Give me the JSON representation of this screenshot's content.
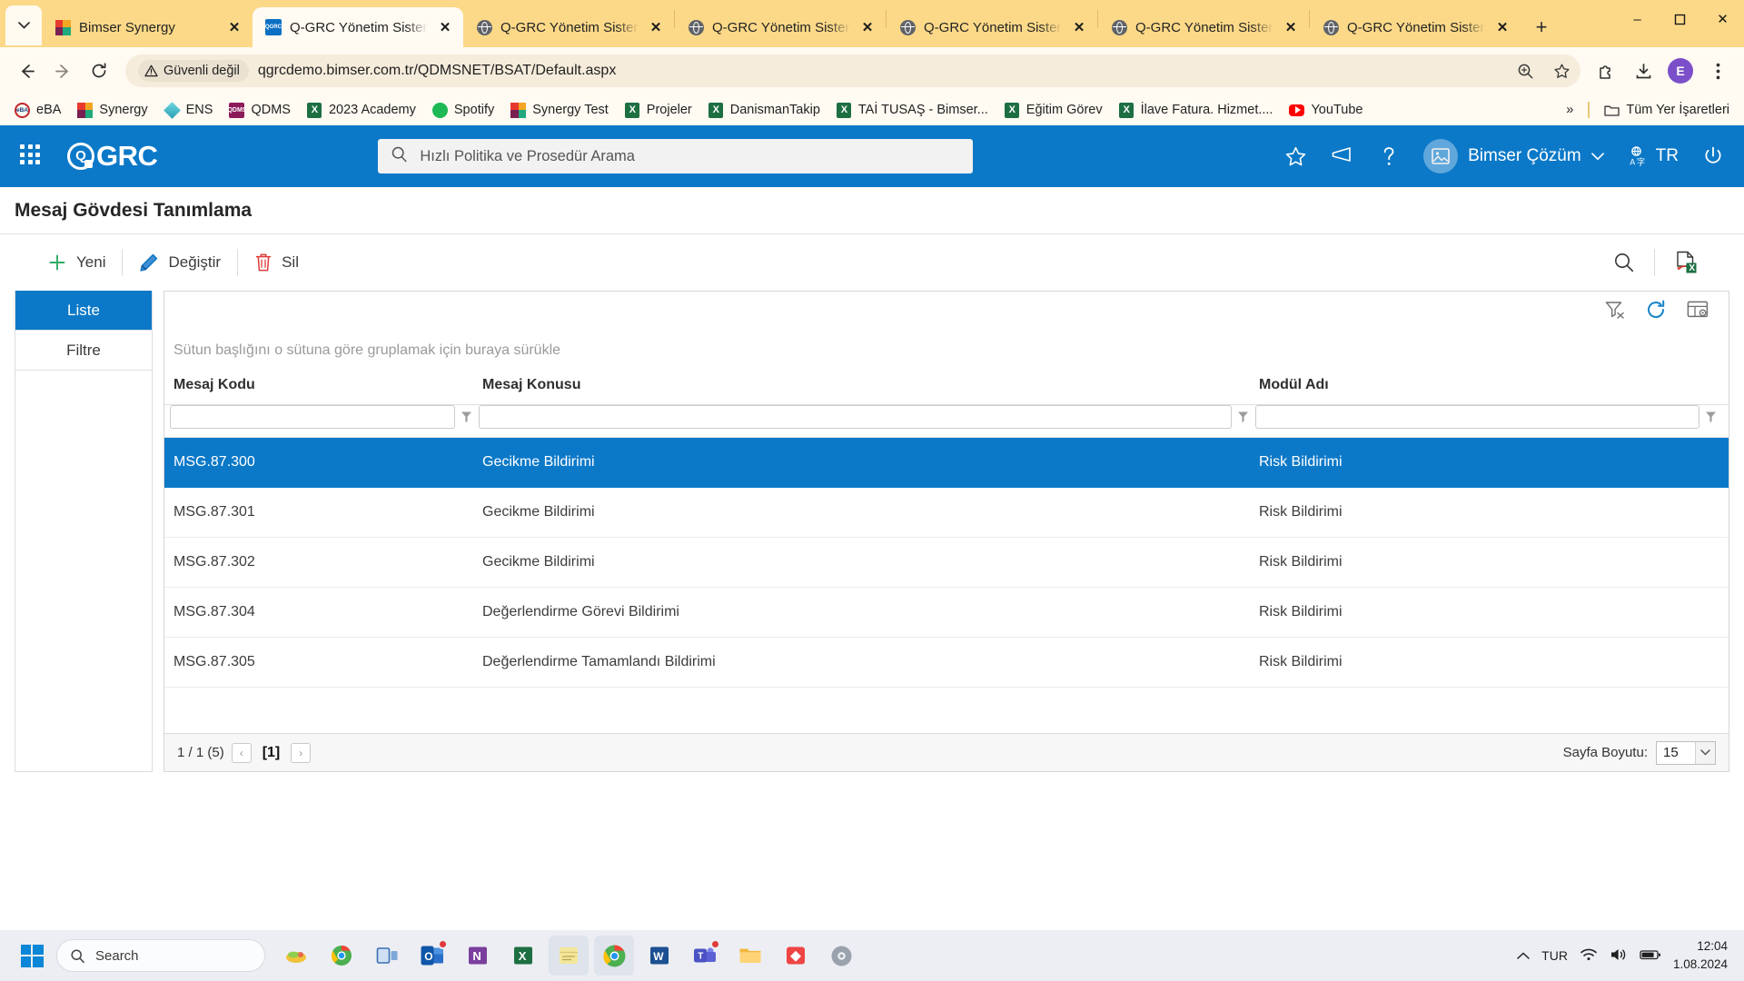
{
  "browser": {
    "tab_list_icon": "chevron-down-icon",
    "tabs": [
      {
        "title": "Bimser Synergy",
        "favicon": "synergy-icon",
        "active": false
      },
      {
        "title": "Q-GRC Yönetim Sistemi",
        "favicon": "qgrc-icon",
        "active": true
      },
      {
        "title": "Q-GRC Yönetim Sistemi",
        "favicon": "globe-icon",
        "active": false
      },
      {
        "title": "Q-GRC Yönetim Sistemi",
        "favicon": "globe-icon",
        "active": false
      },
      {
        "title": "Q-GRC Yönetim Sistemi",
        "favicon": "globe-icon",
        "active": false
      },
      {
        "title": "Q-GRC Yönetim Sistemi",
        "favicon": "globe-icon",
        "active": false
      },
      {
        "title": "Q-GRC Yönetim Sistemi",
        "favicon": "globe-icon",
        "active": false
      }
    ],
    "new_tab_label": "+",
    "window_controls": {
      "minimize": "–",
      "maximize": "☐",
      "close": "✕"
    },
    "nav": {
      "back": "back-icon",
      "forward": "forward-icon",
      "reload": "reload-icon"
    },
    "security_label": "Güvenli değil",
    "url": "qgrcdemo.bimser.com.tr/QDMSNET/BSAT/Default.aspx",
    "profile_initial": "E",
    "bookmarks": [
      {
        "label": "eBA",
        "icon": "eba-icon"
      },
      {
        "label": "Synergy",
        "icon": "synergy-icon"
      },
      {
        "label": "ENS",
        "icon": "ens-icon"
      },
      {
        "label": "QDMS",
        "icon": "qdms-icon"
      },
      {
        "label": "2023 Academy",
        "icon": "excel-icon"
      },
      {
        "label": "Spotify",
        "icon": "spotify-icon"
      },
      {
        "label": "Synergy Test",
        "icon": "synergy-icon"
      },
      {
        "label": "Projeler",
        "icon": "excel-icon"
      },
      {
        "label": "DanismanTakip",
        "icon": "excel-icon"
      },
      {
        "label": "TAİ TUSAŞ - Bimser...",
        "icon": "excel-icon"
      },
      {
        "label": "Eğitim Görev",
        "icon": "excel-icon"
      },
      {
        "label": "İlave Fatura. Hizmet....",
        "icon": "excel-icon"
      },
      {
        "label": "YouTube",
        "icon": "youtube-icon"
      }
    ],
    "bookmarks_overflow": "»",
    "all_bookmarks_label": "Tüm Yer İşaretleri"
  },
  "app_header": {
    "apps_grid_icon": "apps-grid-icon",
    "brand_mark": "Q",
    "brand_text": "GRC",
    "search_placeholder": "Hızlı Politika ve Prosedür Arama",
    "search_value": "",
    "icons": {
      "favorites": "star-icon",
      "announcements": "megaphone-icon",
      "help": "question-mark-icon",
      "avatar": "user-avatar-icon",
      "language": "translate-icon",
      "logout": "power-icon"
    },
    "user_name": "Bimser Çözüm",
    "user_caret": "chevron-down-icon",
    "language": "TR"
  },
  "page": {
    "title": "Mesaj Gövdesi Tanımlama"
  },
  "toolbar": {
    "new_label": "Yeni",
    "new_icon": "plus-icon",
    "edit_label": "Değiştir",
    "edit_icon": "pencil-icon",
    "delete_label": "Sil",
    "delete_icon": "trash-icon",
    "search_icon": "magnifier-icon",
    "export_excel_icon": "export-excel-icon"
  },
  "side_tabs": [
    {
      "label": "Liste",
      "active": true
    },
    {
      "label": "Filtre",
      "active": false
    }
  ],
  "grid": {
    "tool_icons": {
      "clear_filter": "clear-filter-icon",
      "refresh": "refresh-icon",
      "column_chooser": "column-settings-icon"
    },
    "group_hint": "Sütun başlığını o sütuna göre gruplamak için buraya sürükle",
    "columns": [
      {
        "header": "Mesaj Kodu",
        "filter_value": "",
        "filter_icon": "funnel-icon"
      },
      {
        "header": "Mesaj Konusu",
        "filter_value": "",
        "filter_icon": "funnel-icon"
      },
      {
        "header": "Modül Adı",
        "filter_value": "",
        "filter_icon": "funnel-icon"
      }
    ],
    "rows": [
      {
        "mesaj_kodu": "MSG.87.300",
        "mesaj_konusu": "Gecikme Bildirimi",
        "modul_adi": "Risk Bildirimi",
        "selected": true
      },
      {
        "mesaj_kodu": "MSG.87.301",
        "mesaj_konusu": "Gecikme Bildirimi",
        "modul_adi": "Risk Bildirimi",
        "selected": false
      },
      {
        "mesaj_kodu": "MSG.87.302",
        "mesaj_konusu": "Gecikme Bildirimi",
        "modul_adi": "Risk Bildirimi",
        "selected": false
      },
      {
        "mesaj_kodu": "MSG.87.304",
        "mesaj_konusu": "Değerlendirme Görevi Bildirimi",
        "modul_adi": "Risk Bildirimi",
        "selected": false
      },
      {
        "mesaj_kodu": "MSG.87.305",
        "mesaj_konusu": "Değerlendirme Tamamlandı Bildirimi",
        "modul_adi": "Risk Bildirimi",
        "selected": false
      }
    ],
    "footer": {
      "page_info": "1 / 1 (5)",
      "prev_label": "‹",
      "current_page": "[1]",
      "next_label": "›",
      "page_size_label": "Sayfa Boyutu:",
      "page_size_value": "15"
    }
  },
  "taskbar": {
    "start_icon": "windows-start-icon",
    "search_placeholder": "Search",
    "search_icon": "search-icon",
    "apps": [
      {
        "name": "widgets-icon"
      },
      {
        "name": "chrome-pre-icon"
      },
      {
        "name": "task-view-icon"
      },
      {
        "name": "outlook-icon",
        "badge": true
      },
      {
        "name": "onenote-icon"
      },
      {
        "name": "excel-icon"
      },
      {
        "name": "sticky-notes-icon"
      },
      {
        "name": "chrome-icon",
        "active": true
      },
      {
        "name": "word-icon"
      },
      {
        "name": "teams-icon",
        "badge": true
      },
      {
        "name": "file-explorer-icon"
      },
      {
        "name": "anydesk-icon"
      },
      {
        "name": "settings-icon"
      }
    ],
    "tray": {
      "overflow": "chevron-up-icon",
      "language": "TUR",
      "wifi": "wifi-icon",
      "volume": "volume-icon",
      "battery": "battery-icon"
    },
    "clock_time": "12:04",
    "clock_date": "1.08.2024"
  },
  "colors": {
    "brand_blue": "#0c79c8",
    "chrome_amber": "#fcd988",
    "selected_row": "#0c79c8",
    "danger_red": "#e03a3a",
    "success_green": "#1fa97d"
  }
}
